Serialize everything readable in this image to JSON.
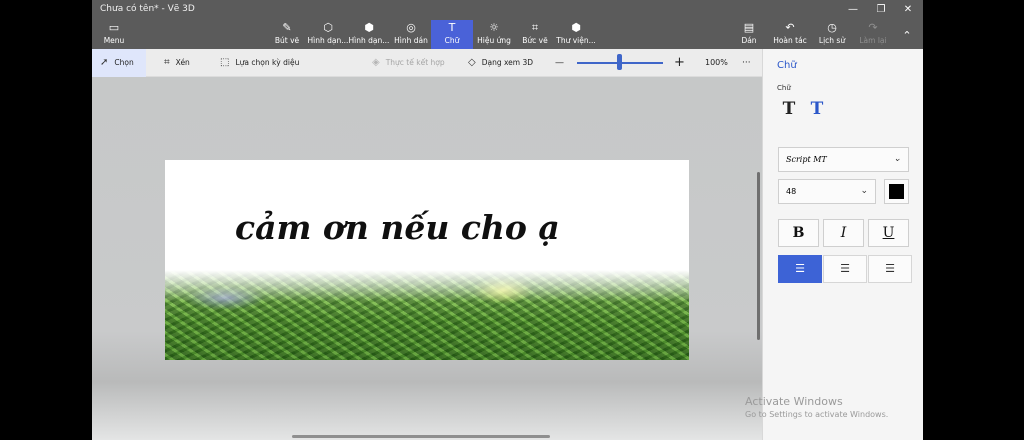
{
  "window": {
    "title": "Chưa có tên* - Vẽ 3D",
    "controls": {
      "minimize": "—",
      "restore": "❐",
      "close": "✕"
    }
  },
  "ribbon": {
    "menu": "Menu",
    "brushes": "Bút vẽ",
    "shapes2d": "Hình dạn...",
    "shapes3d": "Hình dạn...",
    "stickers": "Hình dán",
    "text": "Chữ",
    "effects": "Hiệu ứng",
    "canvas": "Bức vẽ",
    "library": "Thư viện...",
    "paste": "Dán",
    "undo": "Hoàn tác",
    "history": "Lịch sử",
    "redo": "Làm lại"
  },
  "toolbar": {
    "select": "Chọn",
    "crop": "Xén",
    "magic_select": "Lựa chọn kỳ diệu",
    "combine": "Thực tế kết hợp",
    "view3d": "Dạng xem 3D",
    "zoom_value": "100%",
    "zoom_out": "—",
    "zoom_in": "+",
    "more": "···"
  },
  "canvas": {
    "text": "cảm ơn nếu cho ạ"
  },
  "panel": {
    "title": "Chữ",
    "subtitle": "Chữ",
    "font": "Script MT",
    "size": "48",
    "color": "#000000",
    "bold": "B",
    "italic": "I",
    "underline": "U"
  },
  "watermark": {
    "line1": "Activate Windows",
    "line2": "Go to Settings to activate Windows."
  },
  "colors": {
    "accent": "#4a62d8",
    "ribbon_bg": "#5b5b5b"
  }
}
